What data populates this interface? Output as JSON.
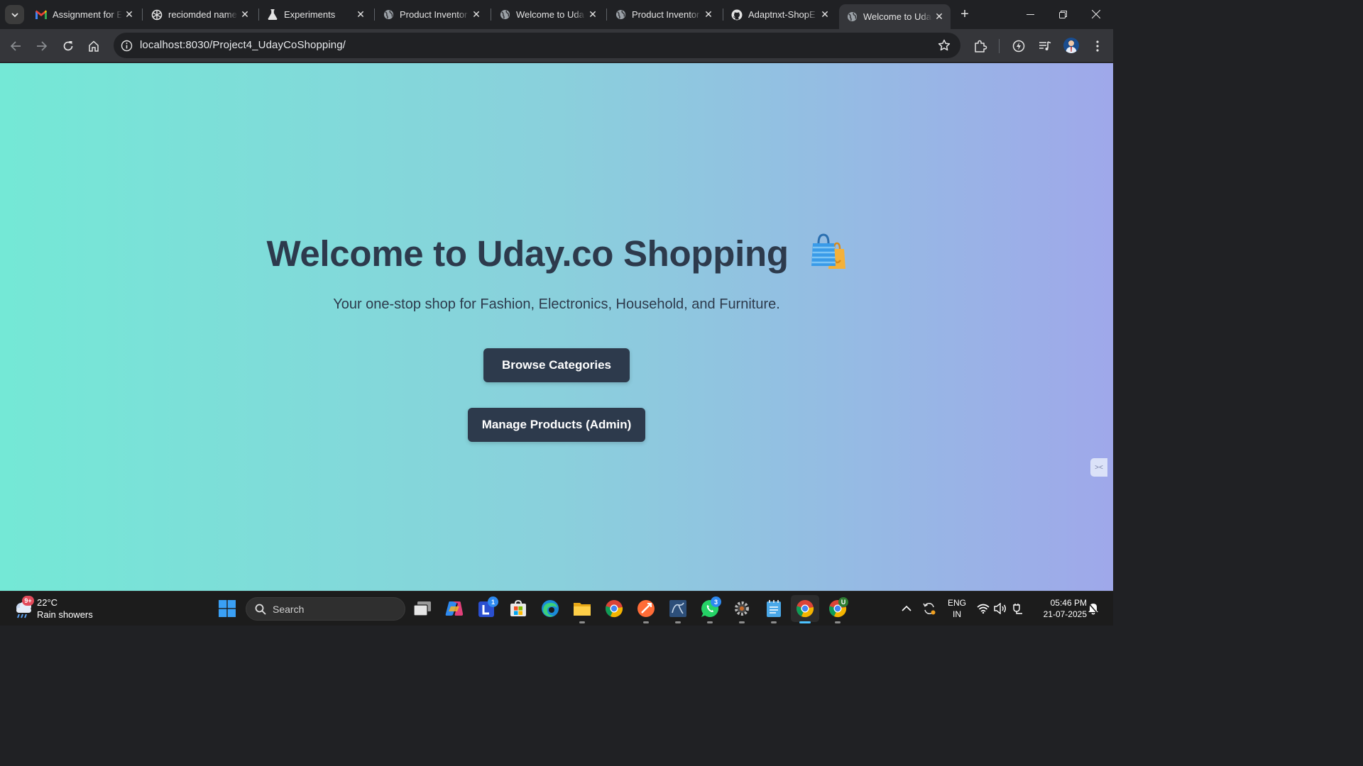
{
  "browser": {
    "tabs": [
      {
        "title": "Assignment for E",
        "icon": "gmail-icon",
        "active": false
      },
      {
        "title": "reciomded name",
        "icon": "openai-icon",
        "active": false
      },
      {
        "title": "Experiments",
        "icon": "flask-icon",
        "active": false
      },
      {
        "title": "Product Inventor",
        "icon": "globe-icon",
        "active": false
      },
      {
        "title": "Welcome to Uda",
        "icon": "globe-icon",
        "active": false
      },
      {
        "title": "Product Inventor",
        "icon": "globe-icon",
        "active": false
      },
      {
        "title": "Adaptnxt-ShopE",
        "icon": "github-icon",
        "active": false
      },
      {
        "title": "Welcome to Uda",
        "icon": "globe-icon",
        "active": true
      }
    ],
    "url": "localhost:8030/Project4_UdayCoShopping/"
  },
  "page": {
    "title": "Welcome to Uday.co Shopping",
    "title_emoji": "🛍️",
    "subtitle": "Your one-stop shop for Fashion, Electronics, Household, and Furniture.",
    "browse_button": "Browse Categories",
    "manage_button": "Manage Products (Admin)",
    "colors": {
      "gradient_start": "#74e8d6",
      "gradient_end": "#9fa8ea",
      "primary_dark": "#2d3a4c"
    }
  },
  "taskbar": {
    "weather": {
      "temp": "22°C",
      "desc": "Rain showers",
      "badge": "9+"
    },
    "search_placeholder": "Search",
    "badges": {
      "teams": "1",
      "whatsapp": "3",
      "chrome_profile": "U"
    },
    "language": {
      "lang": "ENG",
      "region": "IN"
    },
    "clock": {
      "time": "05:46 PM",
      "date": "21-07-2025"
    }
  }
}
